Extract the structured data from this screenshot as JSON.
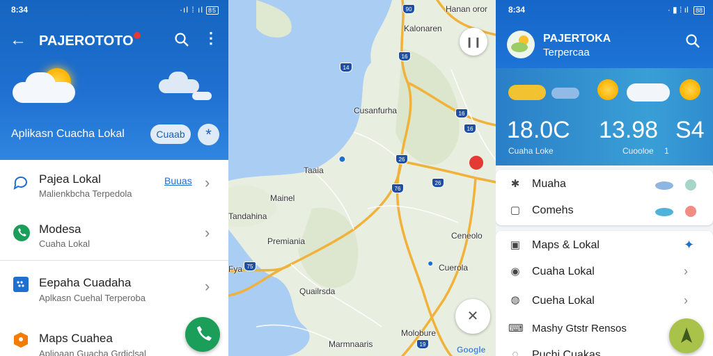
{
  "left_panel": {
    "status": {
      "time": "8:34",
      "icons": "·ıl ⁞ ıl",
      "battery": "85"
    },
    "appbar": {
      "title": "PAJEROTOTO"
    },
    "header": {
      "location_label": "Aplikasn Cuacha Lokal",
      "pill_label": "Cuaab"
    },
    "list": [
      {
        "title": "Pajea Lokal",
        "subtitle": "Malienkbcha Terpedola",
        "link": "Buuas"
      },
      {
        "title": "Modesa",
        "subtitle": "Cuaha Lokal"
      },
      {
        "title": "Eepaha Cuadaha",
        "subtitle": "Aplkasn Cuehal Terperoba"
      },
      {
        "title": "Maps Cuahea",
        "subtitle": "Aplioaan Guacha Grdiclsal"
      }
    ]
  },
  "map": {
    "labels": [
      "Hanan oror",
      "Kalonaren",
      "Cusanfurha",
      "Taaia",
      "Mainel",
      "Premiania",
      "Fya",
      "Cuerola",
      "Ceneolo",
      "Quailrsda",
      "Marmnaaris",
      "Molobure",
      "Tandahina"
    ],
    "shields": [
      "90",
      "16",
      "14",
      "26",
      "76",
      "16",
      "26",
      "75",
      "19",
      "16"
    ],
    "attribution": "Google"
  },
  "right_panel": {
    "status": {
      "time": "8:34",
      "icons": "· ▮ ⁞ ıl",
      "battery": "88"
    },
    "header": {
      "title": "PAJERTOKA",
      "subtitle": "Terpercaa"
    },
    "weather": {
      "temps": [
        "18.0C",
        "13.98",
        "S4"
      ],
      "labels": [
        "Cuaha Loke",
        "Cuooloe",
        "1"
      ]
    },
    "card1": [
      {
        "label": "Muaha"
      },
      {
        "label": "Comehs"
      }
    ],
    "card2": [
      {
        "label": "Maps & Lokal"
      },
      {
        "label": "Cuaha Lokal"
      },
      {
        "label": "Cueha Lokal"
      },
      {
        "label": "Mashy Gtstr Rensos"
      },
      {
        "label": "Puchi Cuakas"
      }
    ]
  },
  "colors": {
    "primary": "#1565c0",
    "accent_green": "#1b9e5a",
    "fab_lime": "#a8c24a"
  }
}
